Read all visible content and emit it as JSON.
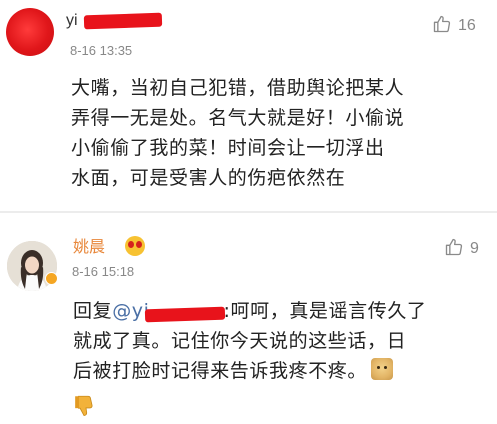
{
  "comments": [
    {
      "username": "yi",
      "timestamp": "8-16 13:35",
      "likes": "16",
      "lines": [
        "大嘴，当初自己犯错，借助舆论把某人",
        "弄得一无是处。名气大就是好！小偷说",
        "小偷偷了我的菜！时间会让一切浮出",
        "水面，可是受害人的伤疤依然在"
      ]
    },
    {
      "username": "姚晨",
      "timestamp": "8-16 15:18",
      "likes": "9",
      "reply_prefix": "回复",
      "mention": "@yi",
      "reply_line1_rest": ":呵呵，真是谣言传久了",
      "lines": [
        "就成了真。记住你今天说的这些话，日",
        "后被打脸时记得来告诉我疼不疼。"
      ]
    }
  ],
  "icons": {
    "like": "thumb-up-icon",
    "dislike": "thumb-down-icon",
    "verified": "verified-badge-icon",
    "emoji": "surprised-emoji-icon",
    "doge": "doge-emoji-icon"
  },
  "colors": {
    "redaction": "#e8131b",
    "vip_name": "#e8873a",
    "mention": "#4a6fa5",
    "muted": "#888888"
  }
}
